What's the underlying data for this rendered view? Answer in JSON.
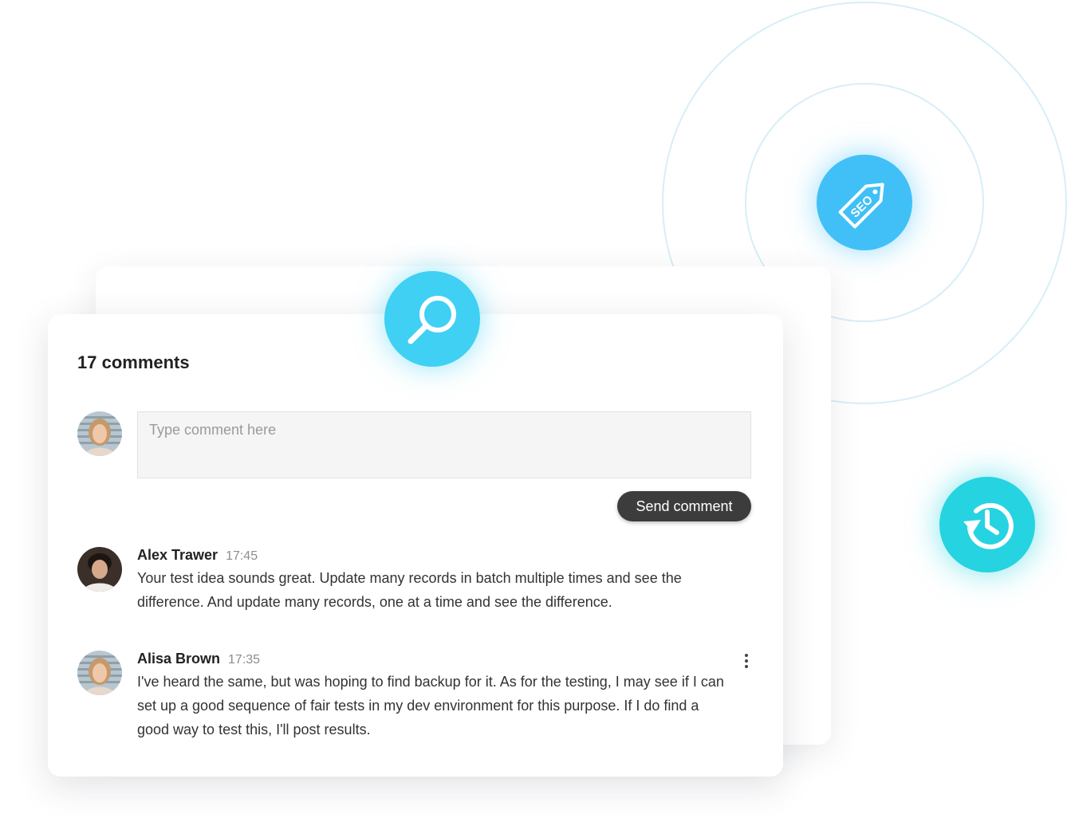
{
  "comments_section": {
    "count_label": "17 comments",
    "input_placeholder": "Type comment here",
    "send_button_label": "Send comment"
  },
  "comments": [
    {
      "author": "Alex Trawer",
      "time": "17:45",
      "text": "Your test idea sounds great. Update many records in batch multiple times and see the difference. And update many records, one at a time and see the difference."
    },
    {
      "author": "Alisa Brown",
      "time": "17:35",
      "text": "I've heard the same, but was hoping to find backup for it. As for the testing, I may see if I can set up a good sequence of fair tests in my dev environment for this purpose. If I do find a good way to test this, I'll post results."
    }
  ],
  "badges": {
    "seo_tag_text": "SEO",
    "search_icon": "magnifier-icon",
    "seo_icon": "seo-tag-icon",
    "history_icon": "history-clock-icon"
  },
  "colors": {
    "search_badge": "#3fd0f4",
    "seo_badge": "#40c0f7",
    "history_badge": "#26d3e1",
    "send_button": "#3c3c3c",
    "ring": "#d7eef8"
  }
}
